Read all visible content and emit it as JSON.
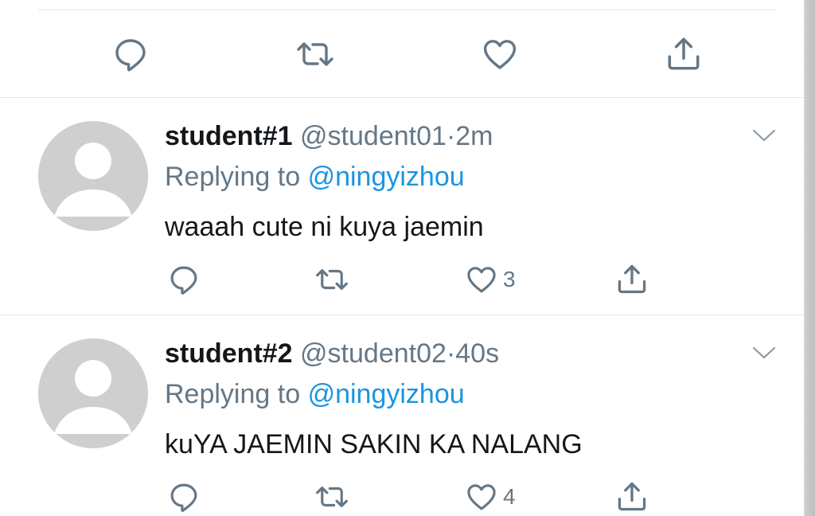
{
  "main_tweet": {
    "actions": {
      "reply_icon": "reply-icon",
      "retweet_icon": "retweet-icon",
      "like_icon": "heart-icon",
      "share_icon": "share-icon"
    }
  },
  "replies": [
    {
      "name": "student#1",
      "handle": "@student01",
      "dot": "·",
      "time": "2m",
      "replying_prefix": "Replying to",
      "replying_to": "@ningyizhou",
      "text": "waaah cute ni kuya jaemin",
      "like_count": "3"
    },
    {
      "name": "student#2",
      "handle": "@student02",
      "dot": "·",
      "time": "40s",
      "replying_prefix": "Replying to",
      "replying_to": "@ningyizhou",
      "text": "kuYA JAEMIN SAKIN KA NALANG",
      "like_count": "4"
    }
  ],
  "colors": {
    "text": "#14171a",
    "secondary": "#657786",
    "link": "#1b95e0",
    "divider": "#e1e8ed",
    "avatar": "#cfcfcf"
  }
}
